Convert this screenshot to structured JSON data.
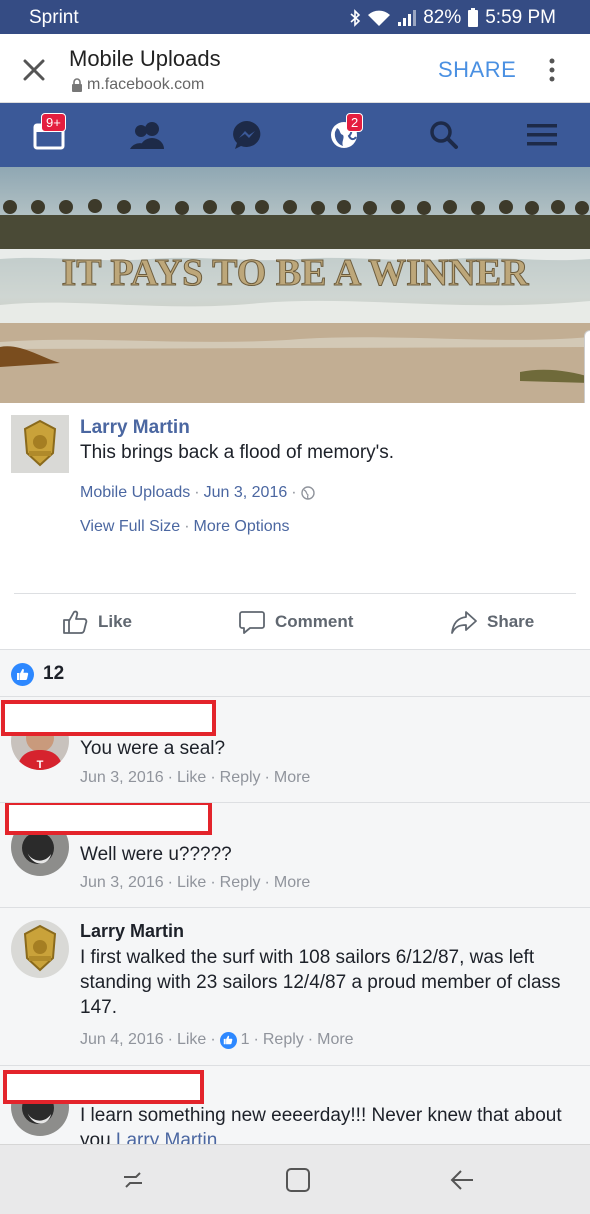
{
  "status_bar": {
    "carrier": "Sprint",
    "battery": "82%",
    "time": "5:59 PM",
    "icons": [
      "bluetooth-icon",
      "wifi-icon",
      "signal-icon",
      "battery-icon"
    ]
  },
  "browser": {
    "title": "Mobile Uploads",
    "url": "m.facebook.com",
    "share_label": "SHARE"
  },
  "fb_nav": {
    "items": [
      {
        "name": "friend-requests",
        "icon": "calendar-icon",
        "badge": "9+"
      },
      {
        "name": "friends",
        "icon": "people-icon",
        "badge": ""
      },
      {
        "name": "messenger",
        "icon": "messenger-icon",
        "badge": ""
      },
      {
        "name": "notifications",
        "icon": "globe-icon",
        "badge": "2"
      },
      {
        "name": "search",
        "icon": "search-icon",
        "badge": ""
      },
      {
        "name": "menu",
        "icon": "hamburger-icon",
        "badge": ""
      }
    ]
  },
  "photo": {
    "caption": "IT PAYS TO BE A WINNER"
  },
  "post": {
    "author": "Larry Martin",
    "text": "This brings back a flood of memory's.",
    "album": "Mobile Uploads",
    "date": "Jun 3, 2016",
    "link_full_size": "View Full Size",
    "link_more_options": "More Options",
    "actions": {
      "like": "Like",
      "comment": "Comment",
      "share": "Share"
    }
  },
  "likes": {
    "count": "12"
  },
  "comments": [
    {
      "author": "",
      "text": "You were a seal?",
      "date": "Jun 3, 2016",
      "like": "Like",
      "reply": "Reply",
      "more": "More"
    },
    {
      "author": "",
      "text": "Well were u?????",
      "date": "Jun 3, 2016",
      "like": "Like",
      "reply": "Reply",
      "more": "More"
    },
    {
      "author": "Larry Martin",
      "text": "I first walked the surf with 108 sailors 6/12/87, was left standing with 23 sailors 12/4/87 a proud member of class 147.",
      "date": "Jun 4, 2016",
      "like": "Like",
      "like_count": "1",
      "reply": "Reply",
      "more": "More"
    },
    {
      "author": "",
      "text": "I learn something new eeeerday!!! Never knew that about you",
      "mention": "Larry Martin"
    }
  ],
  "colors": {
    "status_bar": "#354c84",
    "fb_blue": "#3b5998",
    "link": "#4b67a1",
    "redaction": "#e3242b",
    "like_blue": "#2d88ff"
  }
}
